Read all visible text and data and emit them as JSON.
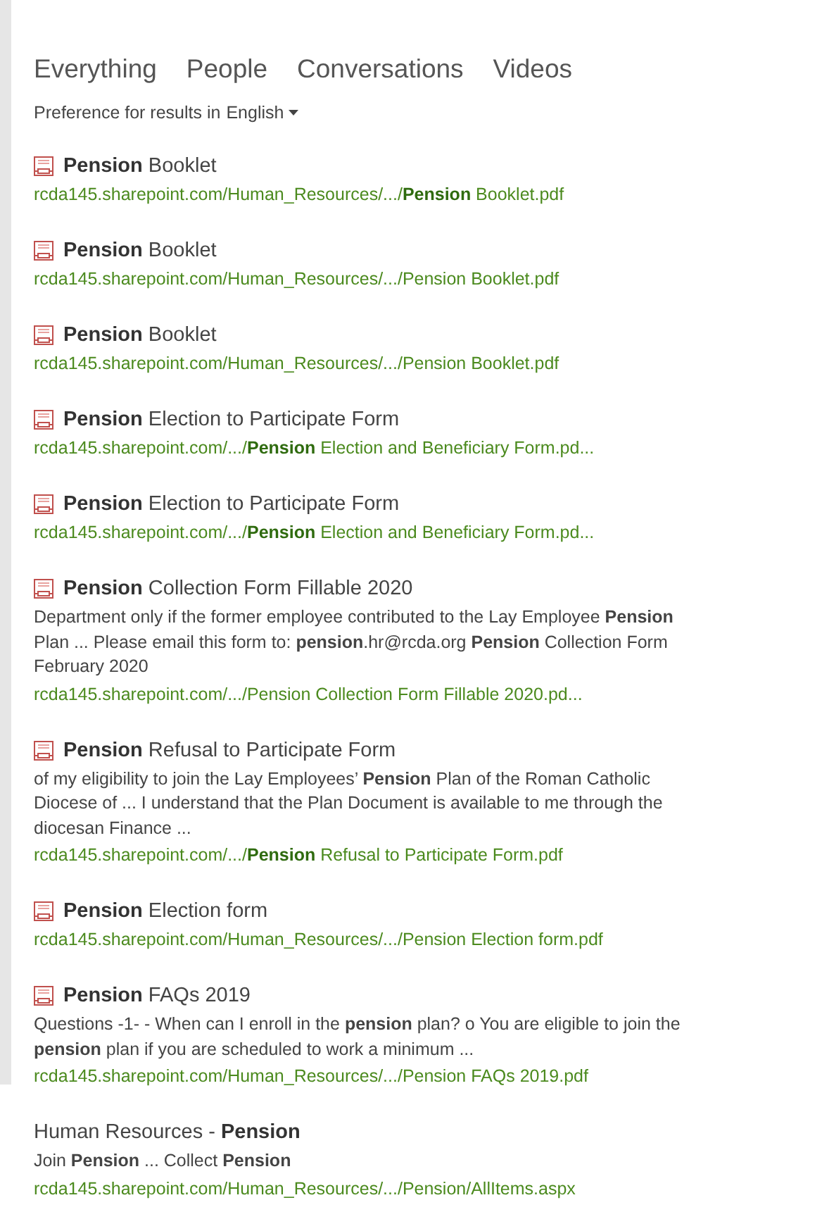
{
  "tabs": [
    {
      "label": "Everything"
    },
    {
      "label": "People"
    },
    {
      "label": "Conversations"
    },
    {
      "label": "Videos"
    }
  ],
  "language_preference": {
    "label": "Preference for results in",
    "value": "English"
  },
  "results": [
    {
      "kind": "pdf",
      "title": "**Pension** Booklet",
      "url": "rcda145.sharepoint.com/Human_Resources/.../**Pension** Booklet.pdf"
    },
    {
      "kind": "pdf",
      "title": "**Pension** Booklet",
      "url": "rcda145.sharepoint.com/Human_Resources/.../Pension Booklet.pdf"
    },
    {
      "kind": "pdf",
      "title": "**Pension** Booklet",
      "url": "rcda145.sharepoint.com/Human_Resources/.../Pension Booklet.pdf"
    },
    {
      "kind": "pdf",
      "title": "**Pension** Election to Participate Form",
      "url": "rcda145.sharepoint.com/.../**Pension** Election and Beneficiary Form.pd..."
    },
    {
      "kind": "pdf",
      "title": "**Pension** Election to Participate Form",
      "url": "rcda145.sharepoint.com/.../**Pension** Election and Beneficiary Form.pd..."
    },
    {
      "kind": "pdf",
      "title": "**Pension** Collection Form Fillable 2020",
      "description": "Department only if the former employee contributed to the Lay Employee **Pension** Plan ... Please email this form to: **pension**.hr@rcda.org **Pension** Collection Form February 2020",
      "url": "rcda145.sharepoint.com/.../Pension Collection Form Fillable 2020.pd..."
    },
    {
      "kind": "pdf",
      "title": "**Pension** Refusal to Participate Form",
      "description": "of my eligibility to join the Lay Employees’ **Pension** Plan of the Roman Catholic Diocese of ... I understand that the Plan Document is available to me through the diocesan Finance ...",
      "url": "rcda145.sharepoint.com/.../**Pension** Refusal to Participate Form.pdf"
    },
    {
      "kind": "pdf",
      "title": "**Pension** Election form",
      "url": "rcda145.sharepoint.com/Human_Resources/.../Pension Election form.pdf"
    },
    {
      "kind": "pdf",
      "title": "**Pension** FAQs 2019",
      "description": "Questions -1- - When can I enroll in the **pension** plan? o You are eligible to join the **pension** plan if you are scheduled to work a minimum ...",
      "url": "rcda145.sharepoint.com/Human_Resources/.../Pension FAQs 2019.pdf"
    },
    {
      "kind": "page",
      "title": "Human Resources - **Pension**",
      "description": "Join **Pension** ... Collect **Pension**",
      "url": "rcda145.sharepoint.com/Human_Resources/.../Pension/AllItems.aspx"
    }
  ]
}
